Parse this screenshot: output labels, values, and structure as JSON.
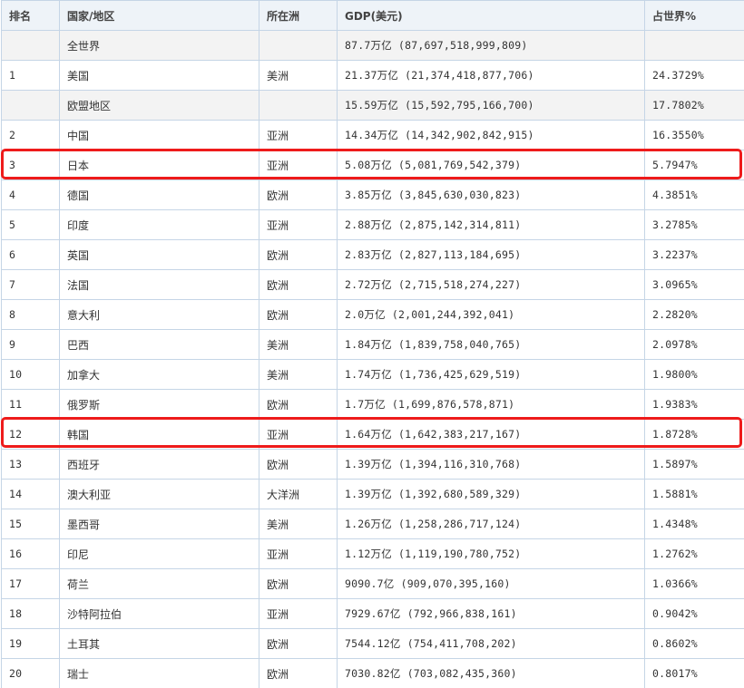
{
  "table": {
    "headers": {
      "rank": "排名",
      "country": "国家/地区",
      "continent": "所在洲",
      "gdp": "GDP(美元)",
      "share": "占世界%"
    },
    "rows": [
      {
        "rank": "",
        "country": "全世界",
        "continent": "",
        "gdp": "87.7万亿 (87,697,518,999,809)",
        "share": "",
        "shaded": true
      },
      {
        "rank": "1",
        "country": "美国",
        "continent": "美洲",
        "gdp": "21.37万亿 (21,374,418,877,706)",
        "share": "24.3729%"
      },
      {
        "rank": "",
        "country": "欧盟地区",
        "continent": "",
        "gdp": "15.59万亿 (15,592,795,166,700)",
        "share": "17.7802%",
        "shaded": true
      },
      {
        "rank": "2",
        "country": "中国",
        "continent": "亚洲",
        "gdp": "14.34万亿 (14,342,902,842,915)",
        "share": "16.3550%"
      },
      {
        "rank": "3",
        "country": "日本",
        "continent": "亚洲",
        "gdp": "5.08万亿 (5,081,769,542,379)",
        "share": "5.7947%",
        "highlighted": true
      },
      {
        "rank": "4",
        "country": "德国",
        "continent": "欧洲",
        "gdp": "3.85万亿 (3,845,630,030,823)",
        "share": "4.3851%"
      },
      {
        "rank": "5",
        "country": "印度",
        "continent": "亚洲",
        "gdp": "2.88万亿 (2,875,142,314,811)",
        "share": "3.2785%"
      },
      {
        "rank": "6",
        "country": "英国",
        "continent": "欧洲",
        "gdp": "2.83万亿 (2,827,113,184,695)",
        "share": "3.2237%"
      },
      {
        "rank": "7",
        "country": "法国",
        "continent": "欧洲",
        "gdp": "2.72万亿 (2,715,518,274,227)",
        "share": "3.0965%"
      },
      {
        "rank": "8",
        "country": "意大利",
        "continent": "欧洲",
        "gdp": "2.0万亿 (2,001,244,392,041)",
        "share": "2.2820%"
      },
      {
        "rank": "9",
        "country": "巴西",
        "continent": "美洲",
        "gdp": "1.84万亿 (1,839,758,040,765)",
        "share": "2.0978%"
      },
      {
        "rank": "10",
        "country": "加拿大",
        "continent": "美洲",
        "gdp": "1.74万亿 (1,736,425,629,519)",
        "share": "1.9800%"
      },
      {
        "rank": "11",
        "country": "俄罗斯",
        "continent": "欧洲",
        "gdp": "1.7万亿 (1,699,876,578,871)",
        "share": "1.9383%"
      },
      {
        "rank": "12",
        "country": "韩国",
        "continent": "亚洲",
        "gdp": "1.64万亿 (1,642,383,217,167)",
        "share": "1.8728%",
        "highlighted": true
      },
      {
        "rank": "13",
        "country": "西班牙",
        "continent": "欧洲",
        "gdp": "1.39万亿 (1,394,116,310,768)",
        "share": "1.5897%"
      },
      {
        "rank": "14",
        "country": "澳大利亚",
        "continent": "大洋洲",
        "gdp": "1.39万亿 (1,392,680,589,329)",
        "share": "1.5881%"
      },
      {
        "rank": "15",
        "country": "墨西哥",
        "continent": "美洲",
        "gdp": "1.26万亿 (1,258,286,717,124)",
        "share": "1.4348%"
      },
      {
        "rank": "16",
        "country": "印尼",
        "continent": "亚洲",
        "gdp": "1.12万亿 (1,119,190,780,752)",
        "share": "1.2762%"
      },
      {
        "rank": "17",
        "country": "荷兰",
        "continent": "欧洲",
        "gdp": "9090.7亿 (909,070,395,160)",
        "share": "1.0366%"
      },
      {
        "rank": "18",
        "country": "沙特阿拉伯",
        "continent": "亚洲",
        "gdp": "7929.67亿 (792,966,838,161)",
        "share": "0.9042%"
      },
      {
        "rank": "19",
        "country": "土耳其",
        "continent": "欧洲",
        "gdp": "7544.12亿 (754,411,708,202)",
        "share": "0.8602%"
      },
      {
        "rank": "20",
        "country": "瑞士",
        "continent": "欧洲",
        "gdp": "7030.82亿 (703,082,435,360)",
        "share": "0.8017%"
      }
    ]
  },
  "colors": {
    "border": "#c5d5e6",
    "header_bg": "#eef3f8",
    "shaded_row_bg": "#f3f3f3",
    "highlight": "#ee1b1b"
  }
}
